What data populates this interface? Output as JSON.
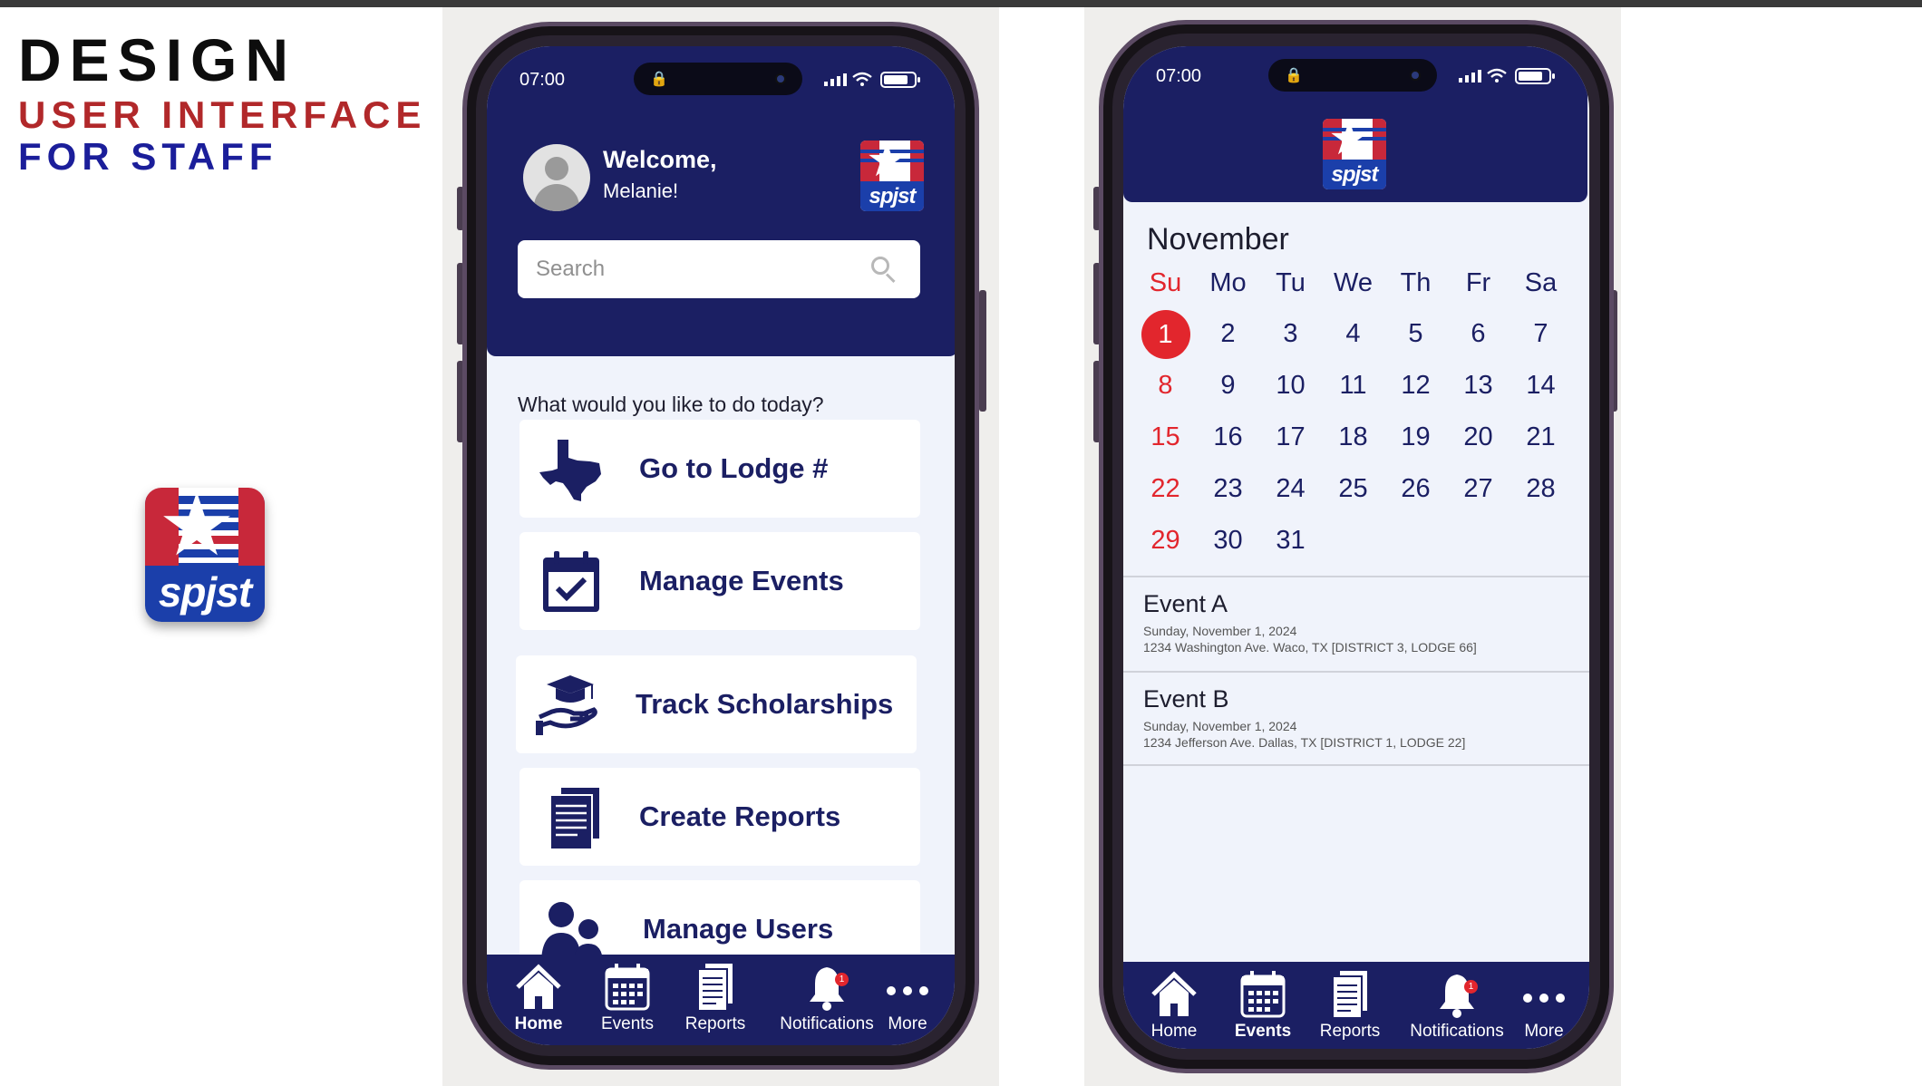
{
  "slide": {
    "title_line1": "DESIGN",
    "title_line2": "USER INTERFACE",
    "title_line3": "FOR STAFF",
    "logo_text": "spjst"
  },
  "colors": {
    "navy": "#1b1f63",
    "red": "#e2262d",
    "title_red": "#b1282a",
    "title_blue": "#1b1e9a",
    "screen_bg": "#f0f3fb"
  },
  "home_screen": {
    "status": {
      "time": "07:00"
    },
    "welcome": "Welcome,",
    "user_name": "Melanie!",
    "search_placeholder": "Search",
    "prompt": "What would you like to do today?",
    "actions": [
      {
        "label": "Go to Lodge #",
        "icon": "texas-map-icon"
      },
      {
        "label": "Manage Events",
        "icon": "calendar-check-icon"
      },
      {
        "label": "Track Scholarships",
        "icon": "graduation-cap-hand-icon"
      },
      {
        "label": "Create Reports",
        "icon": "document-icon"
      },
      {
        "label": "Manage Users",
        "icon": "users-icon"
      }
    ],
    "tabs": [
      {
        "label": "Home",
        "icon": "home-icon",
        "active": true
      },
      {
        "label": "Events",
        "icon": "calendar-icon"
      },
      {
        "label": "Reports",
        "icon": "report-icon"
      },
      {
        "label": "Notifications",
        "icon": "bell-icon",
        "badge": "1"
      },
      {
        "label": "More",
        "icon": "more-dots-icon"
      }
    ]
  },
  "events_screen": {
    "status": {
      "time": "07:00"
    },
    "month": "November",
    "weekdays": [
      "Su",
      "Mo",
      "Tu",
      "We",
      "Th",
      "Fr",
      "Sa"
    ],
    "weeks": [
      [
        "1",
        "2",
        "3",
        "4",
        "5",
        "6",
        "7"
      ],
      [
        "8",
        "9",
        "10",
        "11",
        "12",
        "13",
        "14"
      ],
      [
        "15",
        "16",
        "17",
        "18",
        "19",
        "20",
        "21"
      ],
      [
        "22",
        "23",
        "24",
        "25",
        "26",
        "27",
        "28"
      ],
      [
        "29",
        "30",
        "31",
        "",
        "",
        "",
        ""
      ]
    ],
    "selected_day": "1",
    "events": [
      {
        "name": "Event A",
        "date": "Sunday, November 1, 2024",
        "address": "1234 Washington Ave. Waco, TX [DISTRICT 3, LODGE 66]"
      },
      {
        "name": "Event B",
        "date": "Sunday, November 1, 2024",
        "address": "1234 Jefferson Ave. Dallas, TX [DISTRICT 1, LODGE 22]"
      }
    ],
    "tabs": [
      {
        "label": "Home",
        "icon": "home-icon"
      },
      {
        "label": "Events",
        "icon": "calendar-icon",
        "active": true
      },
      {
        "label": "Reports",
        "icon": "report-icon"
      },
      {
        "label": "Notifications",
        "icon": "bell-icon",
        "badge": "1"
      },
      {
        "label": "More",
        "icon": "more-dots-icon"
      }
    ]
  }
}
